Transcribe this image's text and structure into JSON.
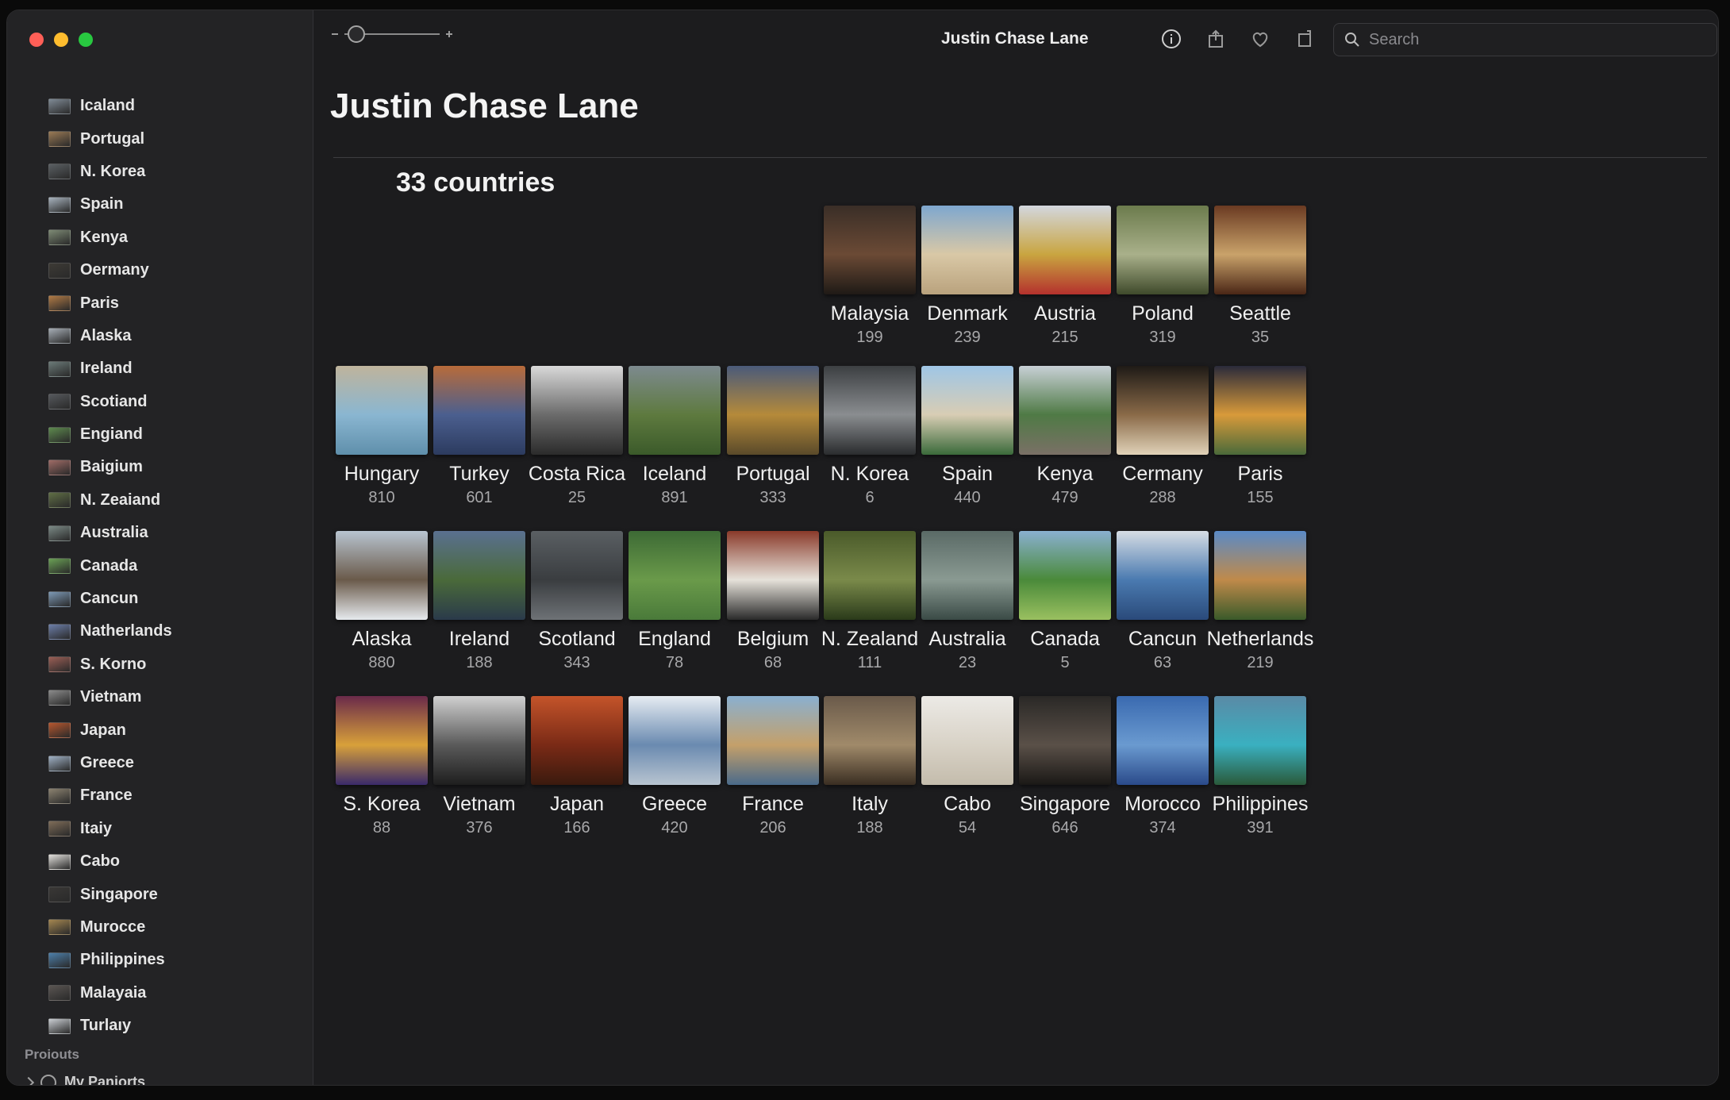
{
  "window": {
    "title": "Justin Chase Lane"
  },
  "search": {
    "placeholder": "Search"
  },
  "page": {
    "title": "Justin Chase Lane",
    "count_label": "33 countries"
  },
  "sidebar": {
    "items": [
      {
        "label": "Icaland",
        "color": "#7f8a95"
      },
      {
        "label": "Portugal",
        "color": "#9a7a55"
      },
      {
        "label": "N. Korea",
        "color": "#5a5f63"
      },
      {
        "label": "Spain",
        "color": "#a7b2bd"
      },
      {
        "label": "Kenya",
        "color": "#7d8a74"
      },
      {
        "label": "Oermany",
        "color": "#3d3a35"
      },
      {
        "label": "Paris",
        "color": "#b07a45"
      },
      {
        "label": "Alaska",
        "color": "#a6adb5"
      },
      {
        "label": "Ireland",
        "color": "#6b7a78"
      },
      {
        "label": "Scotiand",
        "color": "#55585c"
      },
      {
        "label": "Engiand",
        "color": "#5d8a4e"
      },
      {
        "label": "Baigium",
        "color": "#9e6b66"
      },
      {
        "label": "N. Zeaiand",
        "color": "#5f6e45"
      },
      {
        "label": "Australia",
        "color": "#7b8a86"
      },
      {
        "label": "Canada",
        "color": "#6aa055"
      },
      {
        "label": "Cancun",
        "color": "#7c98b4"
      },
      {
        "label": "Natherlands",
        "color": "#6c7ea8"
      },
      {
        "label": "S. Korno",
        "color": "#9a5e55"
      },
      {
        "label": "Vietnam",
        "color": "#8a8a8a"
      },
      {
        "label": "Japan",
        "color": "#b5562e"
      },
      {
        "label": "Greece",
        "color": "#9fb0c4"
      },
      {
        "label": "France",
        "color": "#8b8270"
      },
      {
        "label": "Itaiy",
        "color": "#7e6c58"
      },
      {
        "label": "Cabo",
        "color": "#e2e0dc"
      },
      {
        "label": "Singapore",
        "color": "#3a3836"
      },
      {
        "label": "Murocce",
        "color": "#a38650"
      },
      {
        "label": "Philippines",
        "color": "#4c7ea8"
      },
      {
        "label": "Malayaia",
        "color": "#5a5552"
      },
      {
        "label": "Turlaıy",
        "color": "#c9cdd2"
      }
    ],
    "section_label": "Proiouts",
    "my_projects_label": "My Panjorts"
  },
  "icons": {
    "info": "info-icon",
    "share": "share-icon",
    "favorite": "heart-icon",
    "rotate": "rotate-icon",
    "search": "search-icon"
  },
  "tiles": [
    {
      "name": "Malaysia",
      "count": "199",
      "colors": [
        "#3a2e27",
        "#6b4a35",
        "#1f1a16"
      ]
    },
    {
      "name": "Denmark",
      "count": "239",
      "colors": [
        "#7ea7cf",
        "#d9c8a6",
        "#b9a27d"
      ]
    },
    {
      "name": "Austria",
      "count": "215",
      "colors": [
        "#d3d7de",
        "#c9a540",
        "#b4312d"
      ]
    },
    {
      "name": "Poland",
      "count": "319",
      "colors": [
        "#6b7b4c",
        "#a9b08a",
        "#3f4a2b"
      ]
    },
    {
      "name": "Seattle",
      "count": "35",
      "colors": [
        "#6a3a22",
        "#c9a26a",
        "#4a2616"
      ]
    },
    {
      "name": "Hungary",
      "count": "810",
      "colors": [
        "#bfb49c",
        "#8ab6d1",
        "#5f8fab"
      ]
    },
    {
      "name": "Turkey",
      "count": "601",
      "colors": [
        "#b86b3a",
        "#4b5f8f",
        "#2c3b5f"
      ]
    },
    {
      "name": "Costa Rica",
      "count": "25",
      "colors": [
        "#d9d9d9",
        "#6b6b6b",
        "#2b2b2b"
      ]
    },
    {
      "name": "Iceland",
      "count": "891",
      "colors": [
        "#7d8a8f",
        "#5e7a3f",
        "#3b5a2a"
      ]
    },
    {
      "name": "Portugal",
      "count": "333",
      "colors": [
        "#4a5a7a",
        "#b58a3a",
        "#5a4a2a"
      ]
    },
    {
      "name": "N. Korea",
      "count": "6",
      "colors": [
        "#3c3f42",
        "#8a8d90",
        "#2a2c2e"
      ]
    },
    {
      "name": "Spain",
      "count": "440",
      "colors": [
        "#9fc6e6",
        "#d8cdb4",
        "#3a6a3a"
      ]
    },
    {
      "name": "Kenya",
      "count": "479",
      "colors": [
        "#c8d0d6",
        "#4f7a45",
        "#7a7066"
      ]
    },
    {
      "name": "Cermany",
      "count": "288",
      "colors": [
        "#1e1a16",
        "#8a6a48",
        "#e0d2b8"
      ]
    },
    {
      "name": "Paris",
      "count": "155",
      "colors": [
        "#2a2a3a",
        "#d89a3a",
        "#4a6a3a"
      ]
    },
    {
      "name": "Alaska",
      "count": "880",
      "colors": [
        "#b8c4d0",
        "#6a5a4a",
        "#e6eaee"
      ]
    },
    {
      "name": "Ireland",
      "count": "188",
      "colors": [
        "#5a7090",
        "#4a6a3a",
        "#2a3a4a"
      ]
    },
    {
      "name": "Scotland",
      "count": "343",
      "colors": [
        "#5a5f63",
        "#3a3d40",
        "#6e7276"
      ]
    },
    {
      "name": "England",
      "count": "78",
      "colors": [
        "#3d6a35",
        "#6a9a4a",
        "#4a7a3a"
      ]
    },
    {
      "name": "Belgium",
      "count": "68",
      "colors": [
        "#8a3a2a",
        "#e6e2da",
        "#2a2a2a"
      ]
    },
    {
      "name": "N. Zealand",
      "count": "111",
      "colors": [
        "#4a5a2a",
        "#7a8a4a",
        "#2a3a1a"
      ]
    },
    {
      "name": "Australia",
      "count": "23",
      "colors": [
        "#5a6a66",
        "#8a9a92",
        "#3a4a46"
      ]
    },
    {
      "name": "Canada",
      "count": "5",
      "colors": [
        "#8ab0d0",
        "#4a8a3a",
        "#9ac060"
      ]
    },
    {
      "name": "Cancun",
      "count": "63",
      "colors": [
        "#d6dde4",
        "#4a7ab0",
        "#2a4a7a"
      ]
    },
    {
      "name": "Netherlands",
      "count": "219",
      "colors": [
        "#5a8ac6",
        "#c08a4a",
        "#3a5a2a"
      ]
    },
    {
      "name": "S. Korea",
      "count": "88",
      "colors": [
        "#6a2a4a",
        "#d8a03a",
        "#3a2a6a"
      ]
    },
    {
      "name": "Vietnam",
      "count": "376",
      "colors": [
        "#d0d0d0",
        "#5a5a5a",
        "#1e1e1e"
      ]
    },
    {
      "name": "Japan",
      "count": "166",
      "colors": [
        "#c4542a",
        "#7a2a16",
        "#3a1a0e"
      ]
    },
    {
      "name": "Greece",
      "count": "420",
      "colors": [
        "#e6ecf2",
        "#6a8ab0",
        "#b8c4d0"
      ]
    },
    {
      "name": "France",
      "count": "206",
      "colors": [
        "#8ab0d0",
        "#c4a06a",
        "#4a6a8a"
      ]
    },
    {
      "name": "Italy",
      "count": "188",
      "colors": [
        "#6a5a4a",
        "#a08a6a",
        "#3a2e22"
      ]
    },
    {
      "name": "Cabo",
      "count": "54",
      "colors": [
        "#eceae6",
        "#d8d2c6",
        "#c4bcac"
      ]
    },
    {
      "name": "Singapore",
      "count": "646",
      "colors": [
        "#2a2826",
        "#5a5048",
        "#1a1816"
      ]
    },
    {
      "name": "Morocco",
      "count": "374",
      "colors": [
        "#3a6ab0",
        "#6a9ad0",
        "#2a4a8a"
      ]
    },
    {
      "name": "Philippines",
      "count": "391",
      "colors": [
        "#5a8aa6",
        "#3ab0c0",
        "#2a5a3a"
      ]
    }
  ]
}
